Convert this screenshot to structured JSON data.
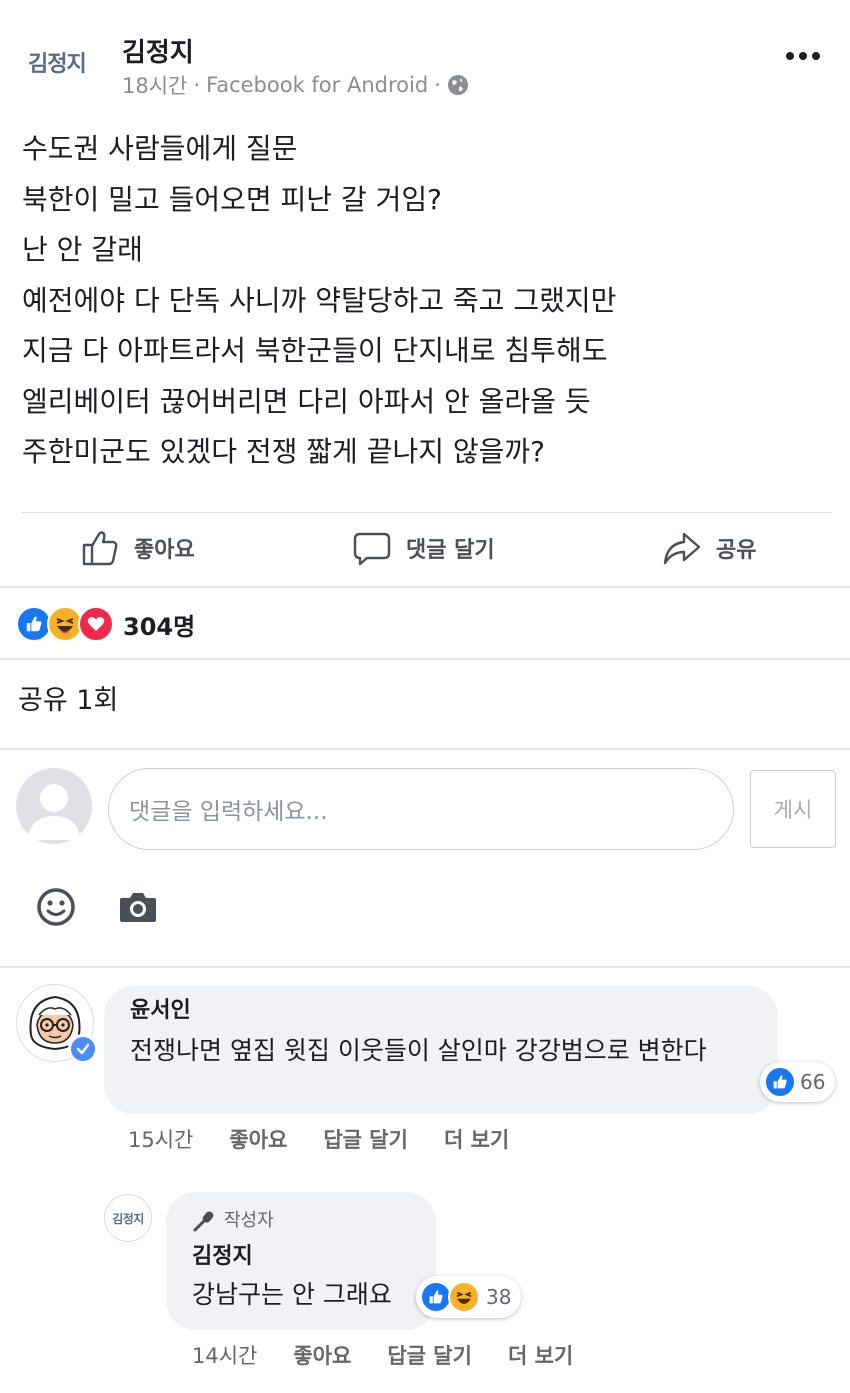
{
  "post": {
    "author_logo": "김정지",
    "author": "김정지",
    "time": "18시간",
    "source": "Facebook for Android",
    "separator": "·",
    "lines": [
      "수도권 사람들에게 질문",
      "북한이 밀고 들어오면 피난 갈 거임?",
      "난 안 갈래",
      "예전에야 다 단독 사니까 약탈당하고 죽고 그랬지만",
      "지금 다 아파트라서 북한군들이 단지내로 침투해도",
      "엘리베이터 끊어버리면 다리 아파서 안 올라올 듯",
      "주한미군도 있겠다 전쟁 짧게 끝나지 않을까?"
    ]
  },
  "actions": {
    "like": "좋아요",
    "comment": "댓글 달기",
    "share": "공유"
  },
  "reactions": {
    "count": "304명",
    "icons": [
      "like-icon",
      "haha-icon",
      "love-icon"
    ]
  },
  "share_count": "공유 1회",
  "composer": {
    "placeholder": "댓글을 입력하세요...",
    "post_button": "게시",
    "tools": [
      "emoji-icon",
      "camera-icon"
    ]
  },
  "comments": [
    {
      "name": "윤서인",
      "text": "전쟁나면 옆집 윗집 이웃들이 살인마 강강범으로 변한다",
      "reaction_count": "66",
      "time": "15시간",
      "like": "좋아요",
      "reply": "답글 달기",
      "more": "더 보기"
    },
    {
      "avatar_logo": "김정지",
      "badge": "작성자",
      "name": "김정지",
      "text": "강남구는 안 그래요",
      "reaction_count": "38",
      "time": "14시간",
      "like": "좋아요",
      "reply": "답글 달기",
      "more": "더 보기"
    }
  ],
  "colors": {
    "accent": "#1877f2",
    "love": "#f0284a",
    "haha": "#f7b125",
    "text": "#1c1e21",
    "muted": "#65676b"
  }
}
